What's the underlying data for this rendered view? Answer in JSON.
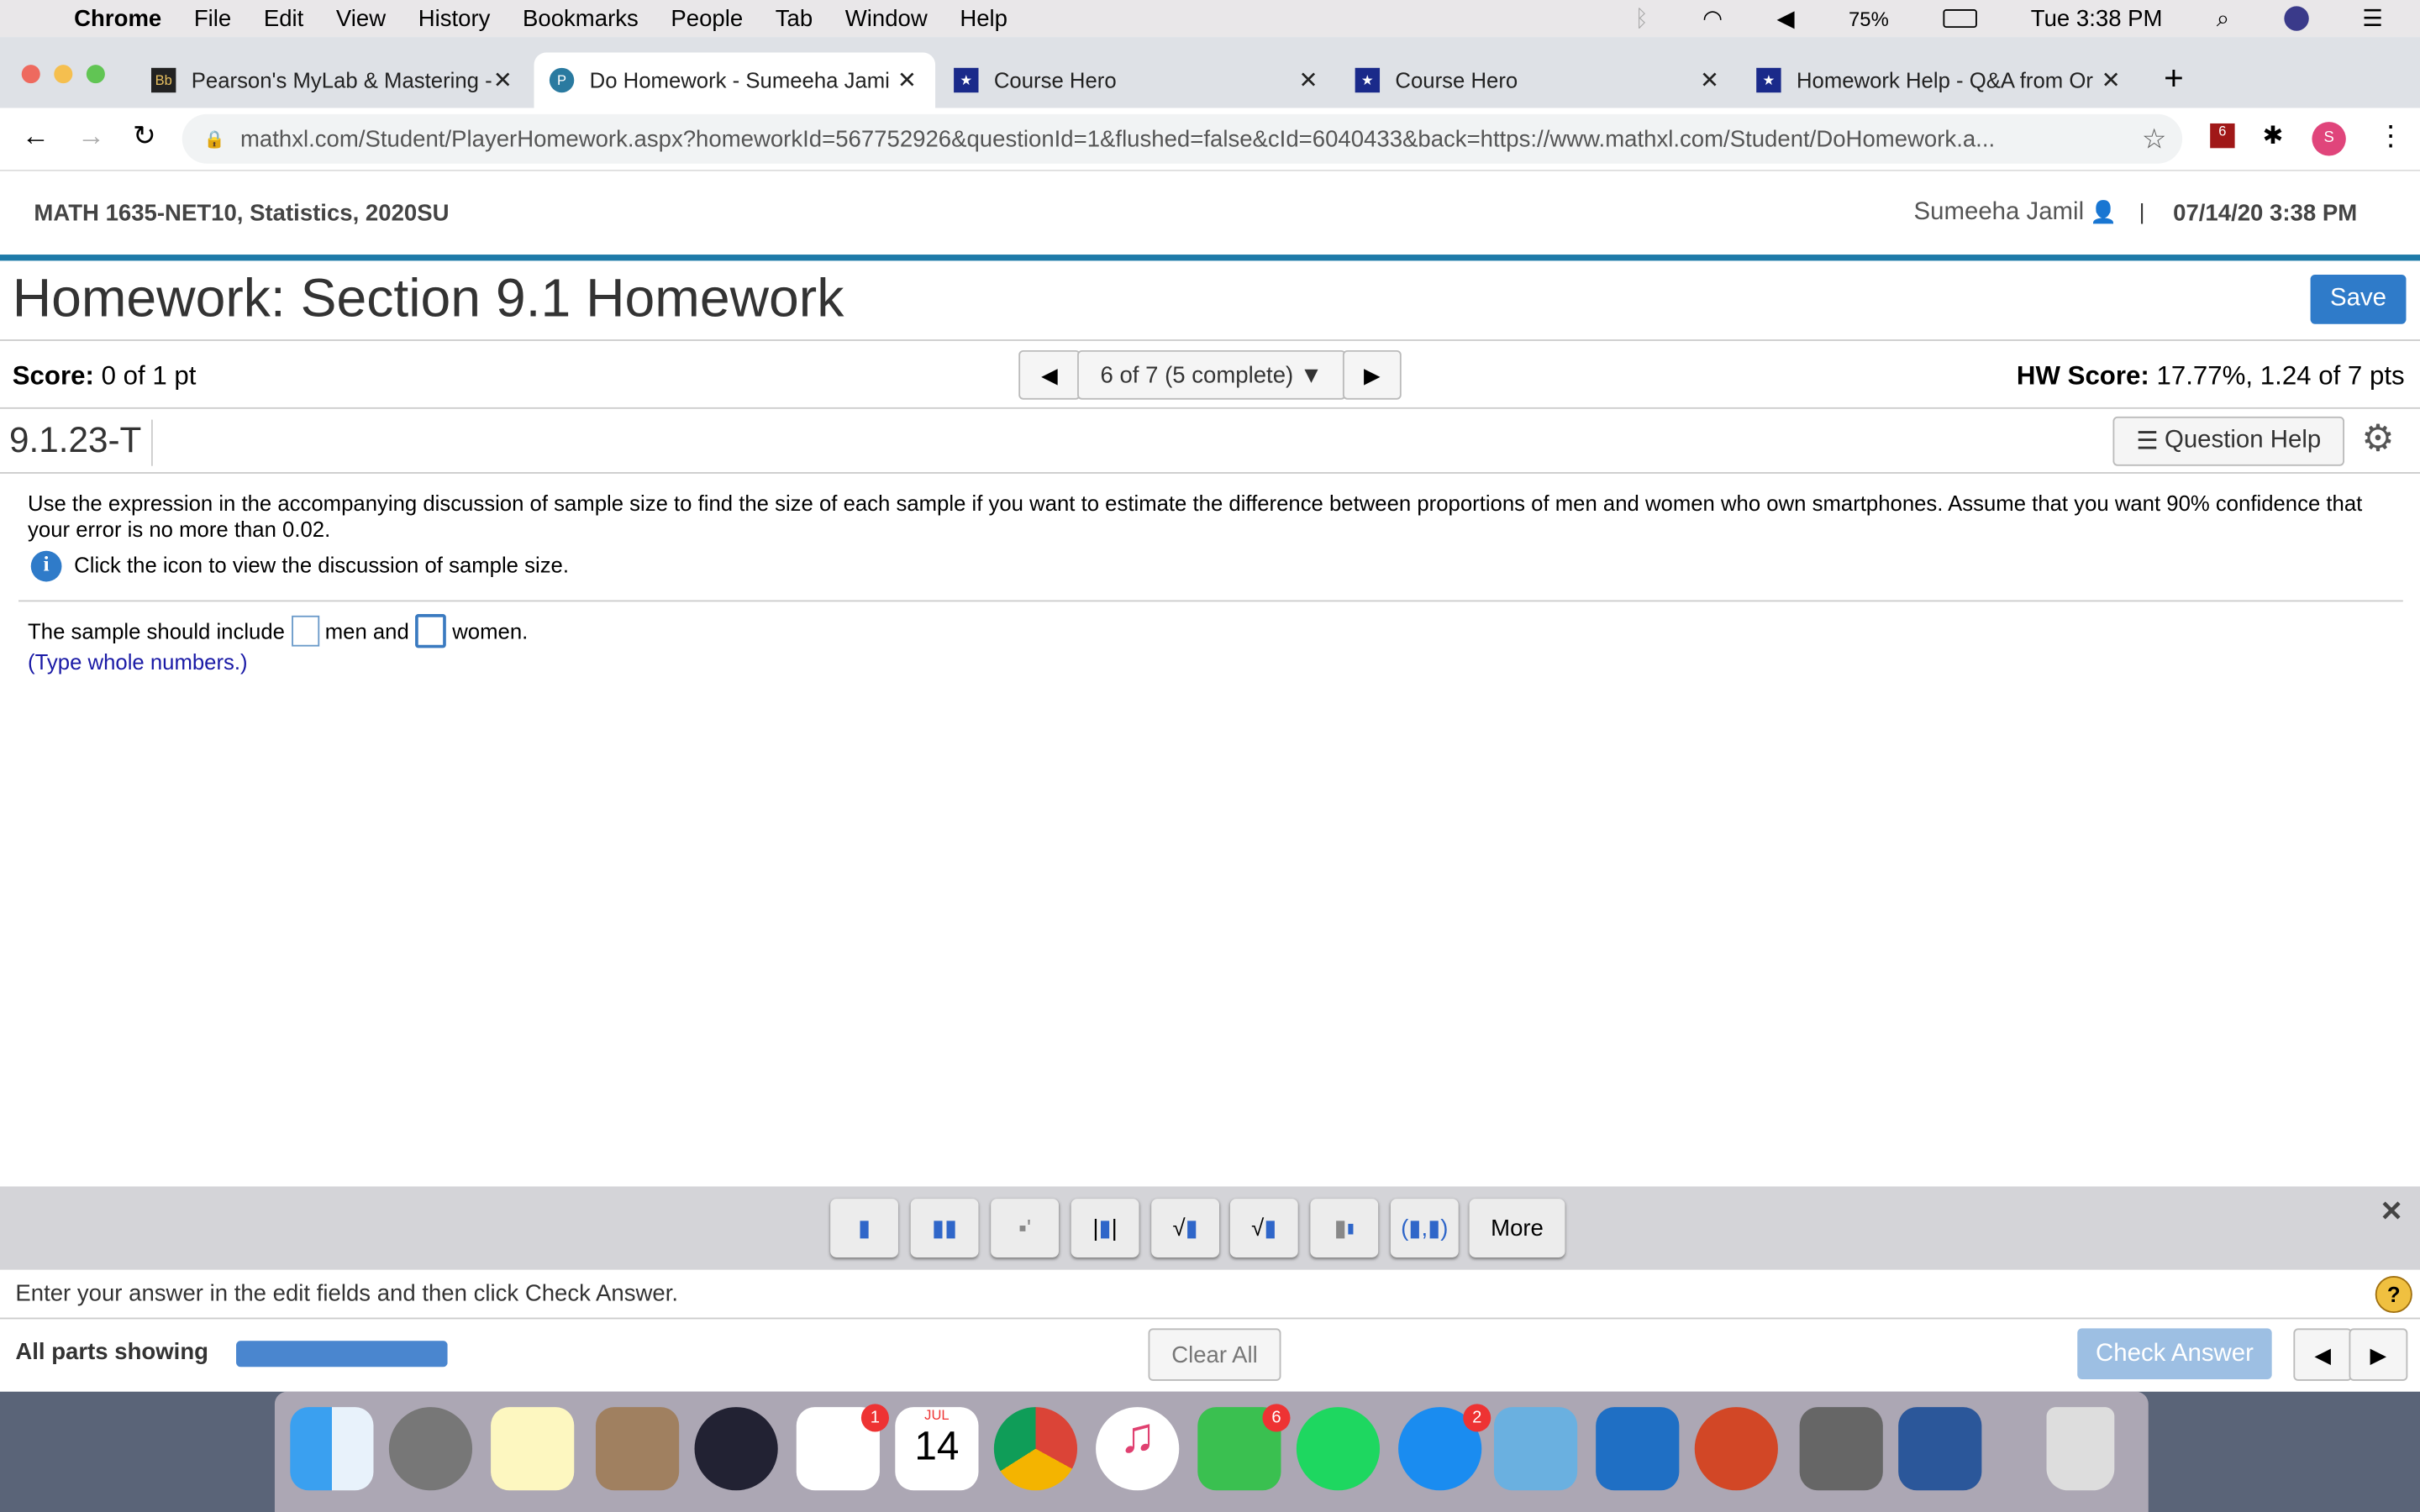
{
  "menubar": {
    "app": "Chrome",
    "items": [
      "File",
      "Edit",
      "View",
      "History",
      "Bookmarks",
      "People",
      "Tab",
      "Window",
      "Help"
    ],
    "battery": "75%",
    "clock": "Tue 3:38 PM"
  },
  "tabs": [
    {
      "title": "Pearson's MyLab & Mastering -",
      "icon": "Bb"
    },
    {
      "title": "Do Homework - Sumeeha Jami",
      "icon": "P"
    },
    {
      "title": "Course Hero",
      "icon": "★"
    },
    {
      "title": "Course Hero",
      "icon": "★"
    },
    {
      "title": "Homework Help - Q&A from Or",
      "icon": "★"
    }
  ],
  "url": "mathxl.com/Student/PlayerHomework.aspx?homeworkId=567752926&questionId=1&flushed=false&cId=6040433&back=https://www.mathxl.com/Student/DoHomework.a...",
  "extension_badge": "6",
  "profile_initial": "S",
  "course": {
    "title": "MATH 1635-NET10, Statistics, 2020SU",
    "user": "Sumeeha Jamil",
    "datetime": "07/14/20 3:38 PM"
  },
  "homework": {
    "title": "Homework: Section 9.1 Homework",
    "save": "Save",
    "score_label": "Score:",
    "score": "0 of 1 pt",
    "nav": "6 of 7 (5 complete)",
    "hw_score_label": "HW Score:",
    "hw_score": "17.77%, 1.24 of 7 pts",
    "question_id": "9.1.23-T",
    "question_help": "Question Help"
  },
  "question": {
    "text": "Use the expression in the accompanying discussion of sample size to find the size of each sample if you want to estimate the difference between proportions of men and women who own smartphones. Assume that you want 90% confidence that your error is no more than 0.02.",
    "info": "Click the icon to view the discussion of sample size.",
    "answer_pre": "The sample should include",
    "answer_mid": "men and",
    "answer_post": "women.",
    "hint": "(Type whole numbers.)",
    "men_value": "",
    "women_value": ""
  },
  "toolbar": {
    "more": "More",
    "icons": [
      "fraction",
      "mixed-number",
      "exponent",
      "absolute-value",
      "square-root",
      "nth-root",
      "subscript",
      "ordered-pair"
    ]
  },
  "footer": {
    "instruction": "Enter your answer in the edit fields and then click Check Answer.",
    "parts": "All parts showing",
    "clear": "Clear All",
    "check": "Check Answer",
    "progress": 1.0
  },
  "dock": {
    "badges": {
      "reminders": "1",
      "facetime": "6",
      "appstore": "2"
    },
    "calendar_month": "JUL",
    "calendar_day": "14"
  },
  "colors": {
    "accent": "#2f7bc9",
    "header_rule": "#1e7aa8",
    "hint": "#1a1aa6"
  }
}
